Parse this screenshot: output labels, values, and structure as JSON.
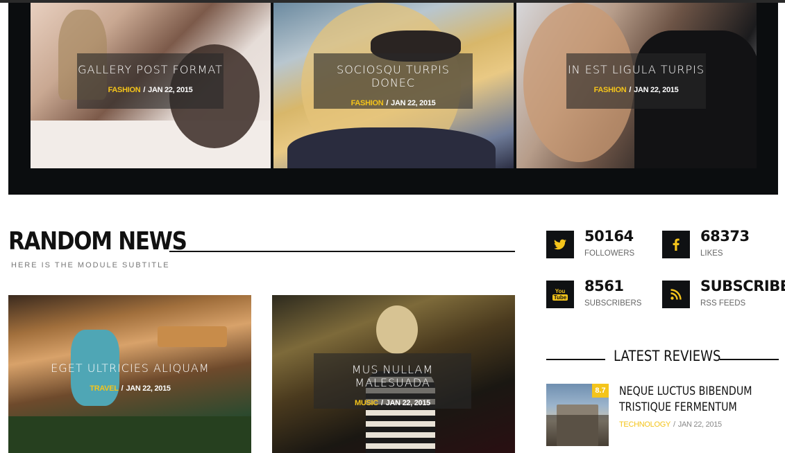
{
  "gallery": [
    {
      "title": "GALLERY POST FORMAT",
      "category": "FASHION",
      "date": "JAN 22, 2015"
    },
    {
      "title": "SOCIOSQU TURPIS DONEC",
      "category": "FASHION",
      "date": "JAN 22, 2015"
    },
    {
      "title": "IN EST LIGULA TURPIS",
      "category": "FASHION",
      "date": "JAN 22, 2015"
    }
  ],
  "random_news": {
    "title": "RANDOM NEWS",
    "subtitle": "HERE IS THE MODULE SUBTITLE",
    "items": [
      {
        "title": "EGET ULTRICIES ALIQUAM",
        "category": "TRAVEL",
        "date": "JAN 22, 2015"
      },
      {
        "title": "MUS NULLAM MALESUADA",
        "category": "MUSIC",
        "date": "JAN 22, 2015"
      }
    ]
  },
  "social": [
    {
      "icon": "twitter-icon",
      "count": "50164",
      "label": "FOLLOWERS"
    },
    {
      "icon": "facebook-icon",
      "count": "68373",
      "label": "LIKES"
    },
    {
      "icon": "youtube-icon",
      "count": "8561",
      "label": "SUBSCRIBERS"
    },
    {
      "icon": "rss-icon",
      "count": "SUBSCRIBE",
      "label": "RSS FEEDS"
    }
  ],
  "latest_reviews": {
    "title": "LATEST REVIEWS",
    "items": [
      {
        "title": "NEQUE LUCTUS BIBENDUM TRISTIQUE FERMENTUM",
        "category": "TECHNOLOGY",
        "date": "JAN 22, 2015",
        "score": "8.7"
      }
    ]
  },
  "colors": {
    "accent": "#f4c41b",
    "dark": "#0b0d0f",
    "text": "#111111"
  },
  "separator": "/"
}
